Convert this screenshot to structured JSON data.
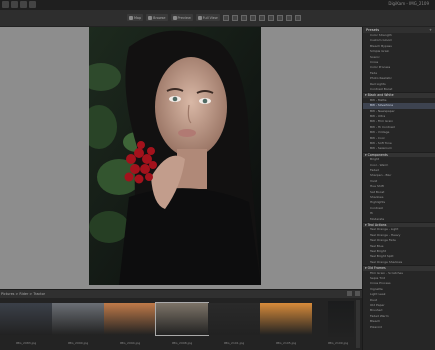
{
  "titlebar": {
    "title": "DigiKam - IMG_2109"
  },
  "toolbar": {
    "items": [
      {
        "icon": "map-icon",
        "label": "Map"
      },
      {
        "icon": "browse-icon",
        "label": "Browse"
      },
      {
        "icon": "preview-icon",
        "label": "Preview"
      },
      {
        "icon": "fullview-icon",
        "label": "Full View"
      }
    ]
  },
  "sidebar": {
    "title": "Presets",
    "groups": [
      {
        "items": [
          "Color Strength",
          "Custom Gloom",
          "Bleach Bypass",
          "Simple Grain",
          "Scenic",
          "Cross",
          "Color Process",
          "Fade",
          "Photo Realistic",
          "Red Lights",
          "Contrast Boost"
        ]
      },
      {
        "title": "Black and White",
        "items": [
          "BW - Matte",
          "BW - Silvertone",
          "BW - Newspaper",
          "BW - Ultra",
          "BW - Film Grain",
          "BW - Hi Contrast",
          "BW - Vintage",
          "BW - Cool",
          "BW - Soft Tone",
          "BW - Selenium"
        ]
      },
      {
        "title": "Components",
        "items": [
          "Bright",
          "Cool - Warm",
          "Faded",
          "Sharpen - Blur",
          "Vivid",
          "Hue Shift",
          "Sat Boost",
          "Shadows",
          "Highlights",
          "Contrast",
          "Hi",
          "Moderate"
        ]
      },
      {
        "title": "Teal Actions",
        "items": [
          "Teal Orange - Light",
          "Teal Orange - Heavy",
          "Teal Orange Fade",
          "Teal Blue",
          "Teal Bright",
          "Teal Bright Split",
          "Teal Orange Shadows"
        ]
      },
      {
        "title": "Old Frames",
        "items": [
          "Film Grain - Scratches",
          "Sepia Tint",
          "Cross Process",
          "Vignette",
          "Light Leak",
          "Dust",
          "Old Paper",
          "Brushed",
          "Faded Warm",
          "Bleach",
          "Polaroid"
        ]
      }
    ],
    "active_item": "BW - Silvertone"
  },
  "filmstrip": {
    "breadcrumb": "Pictures > Rider > Tractor",
    "thumbs": [
      {
        "caption": "IMG_2083.jpg",
        "tone": "#3b4049"
      },
      {
        "caption": "IMG_2090.jpg",
        "tone": "#6b6f75"
      },
      {
        "caption": "IMG_2094.jpg",
        "tone": "#c07a49"
      },
      {
        "caption": "IMG_2098.jpg",
        "tone": "#7d7468"
      },
      {
        "caption": "IMG_2101.jpg",
        "tone": "#2a2a2a"
      },
      {
        "caption": "IMG_2105.jpg",
        "tone": "#d88b3a"
      },
      {
        "caption": "IMG_2109.jpg",
        "tone": "#1b1c1d"
      }
    ]
  }
}
